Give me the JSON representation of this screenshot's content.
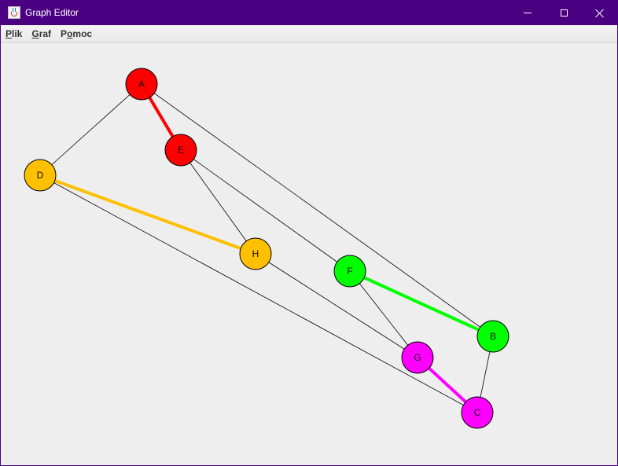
{
  "window": {
    "title": "Graph Editor",
    "controls": {
      "minimize": "minimize",
      "maximize": "maximize",
      "close": "close"
    }
  },
  "menu": {
    "items": [
      {
        "label": "Plik",
        "mnemonic": "P"
      },
      {
        "label": "Graf",
        "mnemonic": "G"
      },
      {
        "label": "Pomoc",
        "mnemonic": "o"
      }
    ]
  },
  "graph": {
    "colors": {
      "red": "#ff0000",
      "orange": "#ffc000",
      "green": "#00ff00",
      "magenta": "#ff00ff",
      "edge": "#000000"
    },
    "nodes": [
      {
        "id": "A",
        "color": "#ff0000"
      },
      {
        "id": "E",
        "color": "#ff0000"
      },
      {
        "id": "D",
        "color": "#ffc000"
      },
      {
        "id": "H",
        "color": "#ffc000"
      },
      {
        "id": "F",
        "color": "#00ff00"
      },
      {
        "id": "B",
        "color": "#00ff00"
      },
      {
        "id": "G",
        "color": "#ff00ff"
      },
      {
        "id": "C",
        "color": "#ff00ff"
      }
    ],
    "edges": [
      {
        "from": "A",
        "to": "E",
        "highlight": "#ff0000"
      },
      {
        "from": "D",
        "to": "H",
        "highlight": "#ffc000"
      },
      {
        "from": "F",
        "to": "B",
        "highlight": "#00ff00"
      },
      {
        "from": "G",
        "to": "C",
        "highlight": "#ff00ff"
      },
      {
        "from": "A",
        "to": "D"
      },
      {
        "from": "A",
        "to": "B"
      },
      {
        "from": "E",
        "to": "H"
      },
      {
        "from": "E",
        "to": "F"
      },
      {
        "from": "D",
        "to": "C"
      },
      {
        "from": "H",
        "to": "G"
      },
      {
        "from": "F",
        "to": "G"
      },
      {
        "from": "B",
        "to": "C"
      }
    ]
  }
}
